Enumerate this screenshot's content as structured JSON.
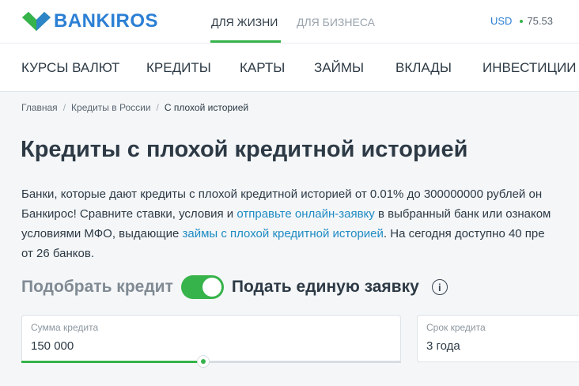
{
  "header": {
    "logo_text": "BANKIROS",
    "segments": [
      {
        "label": "ДЛЯ ЖИЗНИ",
        "active": true
      },
      {
        "label": "ДЛЯ БИЗНЕСА",
        "active": false
      }
    ],
    "currency": "USD",
    "rate": "75.53"
  },
  "nav": [
    "КУРСЫ ВАЛЮТ",
    "КРЕДИТЫ",
    "КАРТЫ",
    "ЗАЙМЫ",
    "ВКЛАДЫ",
    "ИНВЕСТИЦИИ"
  ],
  "breadcrumbs": [
    "Главная",
    "Кредиты в России",
    "С плохой историей"
  ],
  "page": {
    "title": "Кредиты с плохой кредитной историей",
    "line1": "Банки, которые дают кредиты с плохой кредитной историей от 0.01% до 300000000 рублей он",
    "line2_a": "Банкирос! Сравните ставки, условия и ",
    "line2_link": "отправьте онлайн-заявку",
    "line2_b": " в выбранный банк или ознаком",
    "line3_a": "условиями МФО, выдающие ",
    "line3_link": "займы с плохой кредитной историей",
    "line3_b": ". На сегодня доступно 40 пре",
    "line4": "от 26 банков."
  },
  "toggle": {
    "left_label": "Подобрать кредит",
    "right_label": "Подать единую заявку",
    "info_glyph": "i",
    "on": true
  },
  "form": {
    "amount_label": "Сумма кредита",
    "amount_value": "150 000",
    "amount_slider_fraction": 0.48,
    "term_label": "Срок кредита",
    "term_value": "3 года"
  },
  "colors": {
    "brand_blue": "#2b7fd4",
    "accent_green": "#36b34a",
    "link": "#1e8bc3"
  }
}
